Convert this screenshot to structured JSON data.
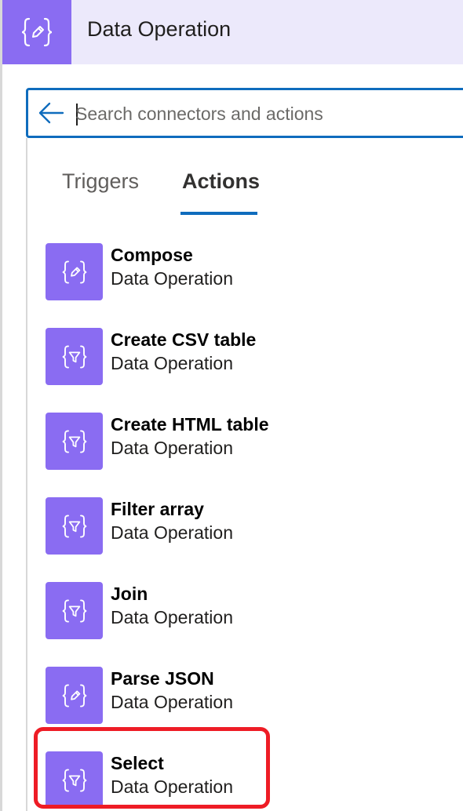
{
  "header": {
    "title": "Data Operation",
    "icon": "braces-pencil-icon"
  },
  "search": {
    "placeholder": "Search connectors and actions",
    "back_icon": "back-arrow-icon"
  },
  "tabs": [
    {
      "label": "Triggers",
      "active": false
    },
    {
      "label": "Actions",
      "active": true
    }
  ],
  "actions": [
    {
      "name": "Compose",
      "connector": "Data Operation",
      "icon": "braces-pencil-icon"
    },
    {
      "name": "Create CSV table",
      "connector": "Data Operation",
      "icon": "braces-filter-icon"
    },
    {
      "name": "Create HTML table",
      "connector": "Data Operation",
      "icon": "braces-filter-icon"
    },
    {
      "name": "Filter array",
      "connector": "Data Operation",
      "icon": "braces-filter-icon"
    },
    {
      "name": "Join",
      "connector": "Data Operation",
      "icon": "braces-filter-icon"
    },
    {
      "name": "Parse JSON",
      "connector": "Data Operation",
      "icon": "braces-pencil-icon"
    },
    {
      "name": "Select",
      "connector": "Data Operation",
      "icon": "braces-filter-icon",
      "highlighted": true
    }
  ],
  "colors": {
    "brand_purple": "#8a6cf2",
    "header_bg": "#ece9fb",
    "accent_blue": "#0f6cbd",
    "highlight_red": "#ee1c25"
  }
}
